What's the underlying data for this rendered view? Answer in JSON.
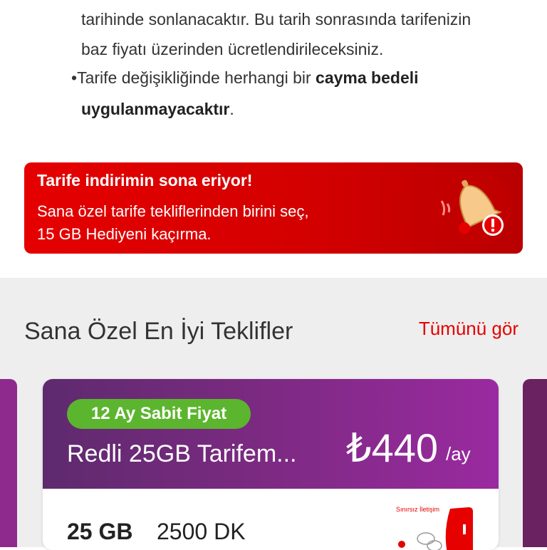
{
  "info": {
    "lines": [
      "tarihinde sonlanacaktır. Bu tarih sonrasında tarifenizin",
      "baz fiyatı üzerinden ücretlendirileceksiniz."
    ],
    "bullet_symbol": "•",
    "bullet_prefix": "Tarife değişikliğinde herhangi bir ",
    "bullet_bold_1": "cayma bedeli",
    "bullet_bold_2": "uygulanmayacaktır",
    "bullet_suffix": "."
  },
  "banner": {
    "title": "Tarife indirimin sona eriyor!",
    "line1": "Sana özel tarife tekliflerinden birini seç,",
    "line2": "15 GB Hediyeni kaçırma.",
    "icon": "bell-alert-icon"
  },
  "offers": {
    "title": "Sana Özel En İyi Teklifler",
    "see_all": "Tümünü gör",
    "card": {
      "badge": "12 Ay Sabit Fiyat",
      "plan_name": "Redli 25GB Tarifem...",
      "price": "₺440",
      "per": "/ay",
      "data": "25 GB",
      "minutes": "2500 DK",
      "promo_text": "Sınırsız İletişim"
    }
  },
  "colors": {
    "accent": "#e60000",
    "card_header": "#7a2a80",
    "badge": "#5cb52e",
    "section_bg": "#eeeeee"
  }
}
